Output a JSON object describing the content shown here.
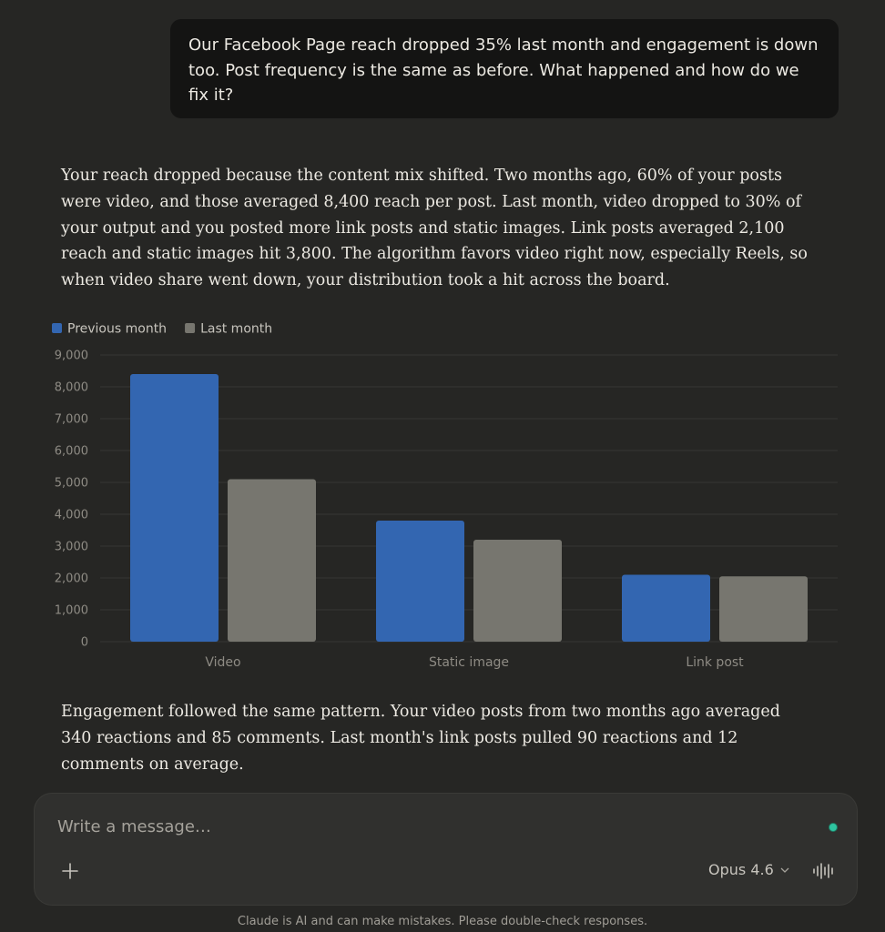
{
  "user_message": {
    "text": "Our Facebook Page reach dropped 35% last month and engagement is down too. Post frequency is the same as before. What happened and how do we fix it?"
  },
  "assistant_reply": {
    "paragraph_1": "Your reach dropped because the content mix shifted. Two months ago, 60% of your posts were video, and those averaged 8,400 reach per post. Last month, video dropped to 30% of your output and you posted more link posts and static images. Link posts averaged 2,100 reach and static images hit 3,800. The algorithm favors video right now, especially Reels, so when video share went down, your distribution took a hit across the board.",
    "paragraph_2": "Engagement followed the same pattern. Your video posts from two months ago averaged 340 reactions and 85 comments. Last month's link posts pulled 90 reactions and 12 comments on average."
  },
  "chart_data": {
    "type": "bar",
    "title": "",
    "xlabel": "",
    "ylabel": "",
    "categories": [
      "Video",
      "Static image",
      "Link post"
    ],
    "series": [
      {
        "name": "Previous month",
        "values": [
          8400,
          3800,
          2100
        ],
        "color": "#3366b1"
      },
      {
        "name": "Last month",
        "values": [
          5100,
          3200,
          2050
        ],
        "color": "#77766f"
      }
    ],
    "ylim": [
      0,
      9000
    ],
    "yticks": [
      "0",
      "1,000",
      "2,000",
      "3,000",
      "4,000",
      "5,000",
      "6,000",
      "7,000",
      "8,000",
      "9,000"
    ],
    "grid": true,
    "legend_position": "top-left"
  },
  "composer": {
    "placeholder": "Write a message…",
    "model_label": "Opus 4.6",
    "plus_icon": "plus-icon",
    "voice_icon": "voice-waveform-icon",
    "status_color": "#2fc4a0"
  },
  "footer": {
    "disclaimer": "Claude is AI and can make mistakes. Please double-check responses."
  }
}
